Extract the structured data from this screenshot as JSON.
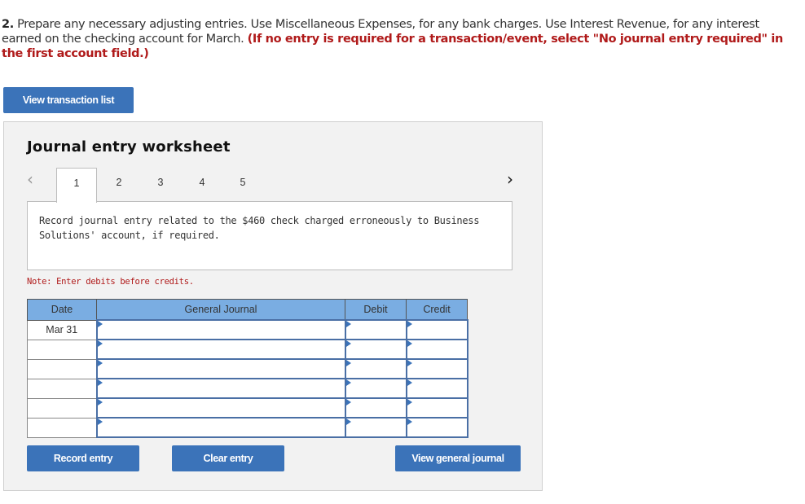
{
  "question": {
    "number": "2.",
    "text": " Prepare any necessary adjusting entries. Use Miscellaneous Expenses, for any bank charges. Use Interest Revenue, for any interest earned on the checking account for March. ",
    "instruction": "(If no entry is required for a transaction/event, select \"No journal entry required\" in the first account field.)"
  },
  "buttons": {
    "view_transaction_list": "View transaction list",
    "record_entry": "Record entry",
    "clear_entry": "Clear entry",
    "view_general_journal": "View general journal"
  },
  "worksheet": {
    "title": "Journal entry worksheet",
    "prev_icon": "‹",
    "next_icon": "›",
    "tabs": [
      {
        "label": "1",
        "active": true
      },
      {
        "label": "2",
        "active": false
      },
      {
        "label": "3",
        "active": false
      },
      {
        "label": "4",
        "active": false
      },
      {
        "label": "5",
        "active": false
      }
    ],
    "description": "Record journal entry related to the $460 check charged erroneously to Business Solutions' account, if required.",
    "note": "Note: Enter debits before credits."
  },
  "journal_table": {
    "headers": {
      "date": "Date",
      "general_journal": "General Journal",
      "debit": "Debit",
      "credit": "Credit"
    },
    "rows": [
      {
        "date": "Mar 31",
        "account": "",
        "debit": "",
        "credit": ""
      },
      {
        "date": "",
        "account": "",
        "debit": "",
        "credit": ""
      },
      {
        "date": "",
        "account": "",
        "debit": "",
        "credit": ""
      },
      {
        "date": "",
        "account": "",
        "debit": "",
        "credit": ""
      },
      {
        "date": "",
        "account": "",
        "debit": "",
        "credit": ""
      },
      {
        "date": "",
        "account": "",
        "debit": "",
        "credit": ""
      }
    ]
  },
  "colors": {
    "button": "#3b73b9",
    "header": "#7aade2",
    "alert_red": "#b01a1a"
  }
}
